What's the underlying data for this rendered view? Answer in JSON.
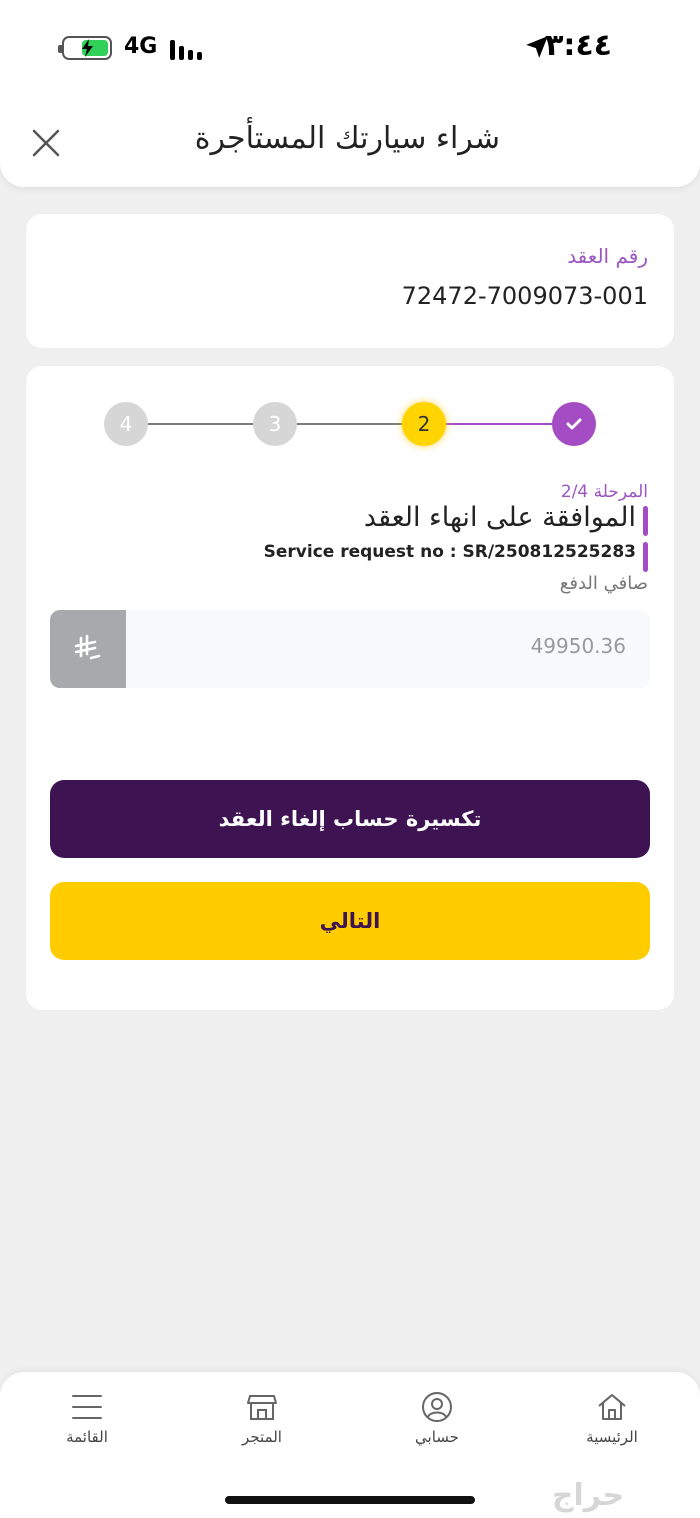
{
  "status_bar": {
    "time": "٣:٤٤",
    "network": "4G"
  },
  "header": {
    "title": "شراء سيارتك المستأجرة"
  },
  "contract": {
    "label": "رقم العقد",
    "number": "72472-7009073-001"
  },
  "stepper": {
    "steps": [
      {
        "label": "✓",
        "state": "done"
      },
      {
        "label": "2",
        "state": "current"
      },
      {
        "label": "3",
        "state": "inactive"
      },
      {
        "label": "4",
        "state": "inactive"
      }
    ],
    "colors": {
      "done": "#a44cc4",
      "current": "#ffd400",
      "inactive": "#d6d6d6"
    }
  },
  "stage": {
    "label": "المرحلة 2/4",
    "title": "الموافقة على انهاء العقد",
    "service_request": "Service request no : SR/250812525283",
    "net_payment_label": "صافي الدفع"
  },
  "amount": {
    "value": "49950.36",
    "currency_icon": "saudi-riyal-icon"
  },
  "buttons": {
    "breakdown": "تكسيرة حساب إلغاء العقد",
    "next": "التالي"
  },
  "bottom_nav": {
    "items": [
      {
        "label": "الرئيسية",
        "icon": "home-icon"
      },
      {
        "label": "حسابي",
        "icon": "user-icon"
      },
      {
        "label": "المتجر",
        "icon": "store-icon"
      },
      {
        "label": "القائمة",
        "icon": "menu-icon"
      }
    ]
  },
  "watermark": "حراج",
  "colors": {
    "primary_purple": "#3d1352",
    "accent_purple": "#a44cc4",
    "accent_yellow": "#ffcc00"
  }
}
